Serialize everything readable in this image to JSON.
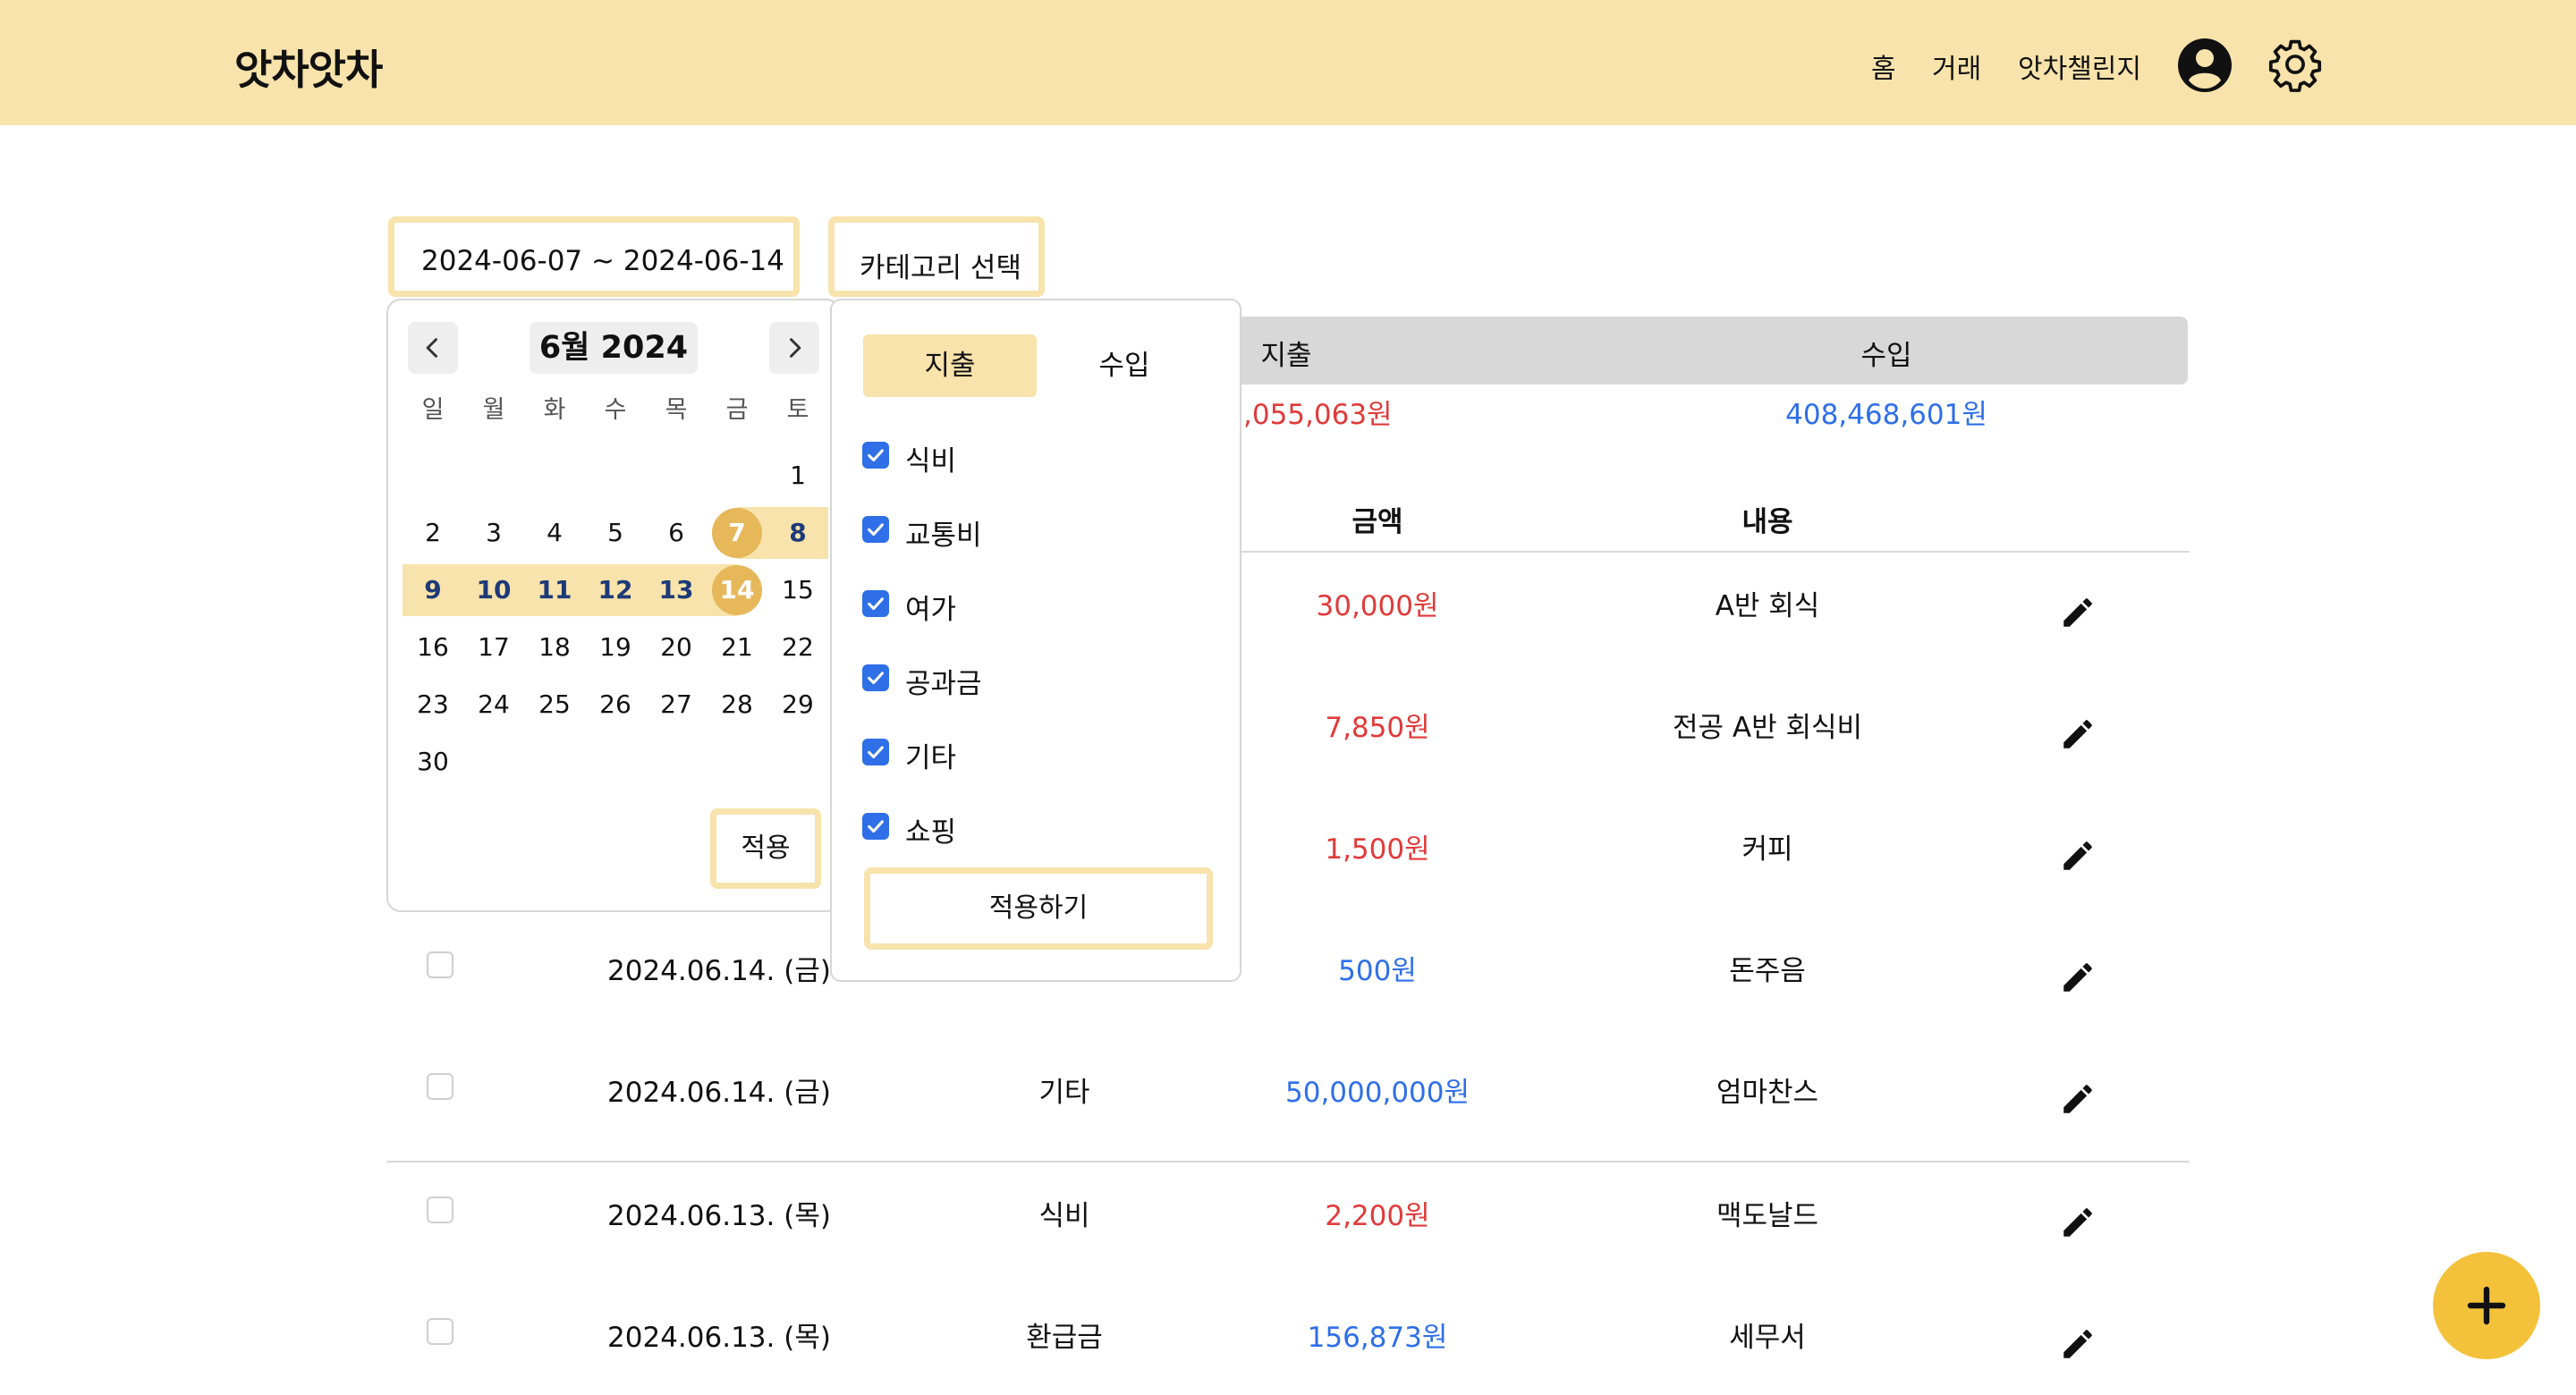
{
  "header": {
    "logo": "앗차앗차",
    "nav": {
      "home": "홈",
      "transactions": "거래",
      "challenge": "앗차챌린지"
    }
  },
  "filters": {
    "date_range": "2024-06-07 ~ 2024-06-14",
    "category_button": "카테고리 선택"
  },
  "summary": {
    "expense_label": "지출",
    "income_label": "수입",
    "expense_value": ",055,063원",
    "income_value": "408,468,601원"
  },
  "table": {
    "headers": {
      "amount": "금액",
      "content": "내용"
    },
    "rows": [
      {
        "date": "",
        "category": "",
        "amount": "30,000원",
        "type": "expense",
        "content": "A반 회식"
      },
      {
        "date": "",
        "category": "",
        "amount": "7,850원",
        "type": "expense",
        "content": "전공 A반 회식비"
      },
      {
        "date": "",
        "category": "",
        "amount": "1,500원",
        "type": "expense",
        "content": "커피"
      },
      {
        "date": "2024.06.14. (금)",
        "category": "",
        "amount": "500원",
        "type": "income",
        "content": "돈주음"
      },
      {
        "date": "2024.06.14. (금)",
        "category": "기타",
        "amount": "50,000,000원",
        "type": "income",
        "content": "엄마찬스"
      },
      {
        "date": "2024.06.13. (목)",
        "category": "식비",
        "amount": "2,200원",
        "type": "expense",
        "content": "맥도날드"
      },
      {
        "date": "2024.06.13. (목)",
        "category": "환급금",
        "amount": "156,873원",
        "type": "income",
        "content": "세무서"
      }
    ]
  },
  "calendar": {
    "title": "6월 2024",
    "weekdays": [
      "일",
      "월",
      "화",
      "수",
      "목",
      "금",
      "토"
    ],
    "weeks": [
      [
        "",
        "",
        "",
        "",
        "",
        "",
        "1"
      ],
      [
        "2",
        "3",
        "4",
        "5",
        "6",
        "7",
        "8"
      ],
      [
        "9",
        "10",
        "11",
        "12",
        "13",
        "14",
        "15"
      ],
      [
        "16",
        "17",
        "18",
        "19",
        "20",
        "21",
        "22"
      ],
      [
        "23",
        "24",
        "25",
        "26",
        "27",
        "28",
        "29"
      ],
      [
        "30",
        "",
        "",
        "",
        "",
        "",
        ""
      ]
    ],
    "range_start": 7,
    "range_end": 14,
    "apply": "적용"
  },
  "category_panel": {
    "tabs": [
      "지출",
      "수입"
    ],
    "items": [
      "식비",
      "교통비",
      "여가",
      "공과금",
      "기타",
      "쇼핑"
    ],
    "apply": "적용하기"
  },
  "colors": {
    "header_bg": "#f7e3ab",
    "accent": "#e6b85a",
    "fab": "#f3c23a",
    "expense": "#e03a3a",
    "income": "#2f6fe8"
  },
  "icons": {
    "profile": "user-circle-icon",
    "settings": "gear-icon",
    "edit": "pencil-icon",
    "add": "plus-icon"
  }
}
